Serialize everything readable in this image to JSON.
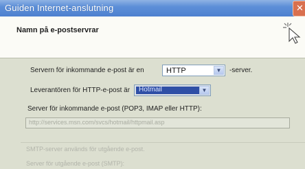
{
  "window": {
    "title": "Guiden Internet-anslutning",
    "close_glyph": "✕"
  },
  "header": {
    "title": "Namn på e-postservrar",
    "icon": "wizard-cursor-icon"
  },
  "form": {
    "incoming_type_prefix": "Servern för inkommande e-post är en",
    "incoming_type_value": "HTTP",
    "incoming_type_suffix": "-server.",
    "provider_label": "Leverantören för HTTP-e-post är",
    "provider_value": "Hotmail",
    "incoming_server_label": "Server för inkommande e-post (POP3, IMAP eller HTTP):",
    "incoming_server_value": "http://services.msn.com/svcs/hotmail/httpmail.asp",
    "smtp_note": "SMTP-server används för utgående e-post.",
    "outgoing_server_label": "Server för utgående e-post (SMTP):"
  },
  "colors": {
    "titlebar": "#5d8fd8",
    "header_bg": "#fbfbf6",
    "body_bg": "#dcdfd0",
    "selection": "#2f4fa6"
  }
}
